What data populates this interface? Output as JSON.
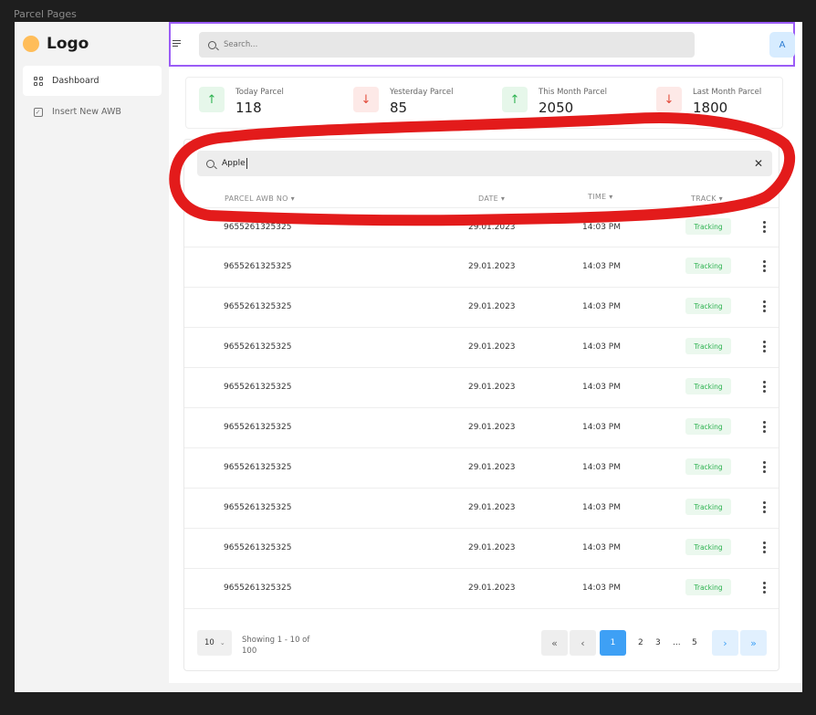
{
  "frame_label": "Parcel Pages",
  "logo": {
    "text": "Logo"
  },
  "sidebar": {
    "items": [
      {
        "label": "Dashboard",
        "icon": "dashboard-grid-icon"
      },
      {
        "label": "Insert New AWB",
        "icon": "checkbox-icon"
      }
    ]
  },
  "topbar": {
    "search_placeholder": "Search...",
    "avatar_initial": "A"
  },
  "stats": [
    {
      "label": "Today Parcel",
      "value": "118",
      "trend": "up"
    },
    {
      "label": "Yesterday Parcel",
      "value": "85",
      "trend": "down"
    },
    {
      "label": "This Month Parcel",
      "value": "2050",
      "trend": "up"
    },
    {
      "label": "Last Month Parcel",
      "value": "1800",
      "trend": "down"
    }
  ],
  "filter": {
    "value": "Apple"
  },
  "table": {
    "headers": {
      "awb": "PARCEL AWB NO ▾",
      "date": "DATE ▾",
      "time": "TIME ▾",
      "track": "TRACK ▾"
    },
    "rows": [
      {
        "awb": "9655261325325",
        "date": "29.01.2023",
        "time": "14:03 PM",
        "track": "Tracking"
      },
      {
        "awb": "9655261325325",
        "date": "29.01.2023",
        "time": "14:03 PM",
        "track": "Tracking"
      },
      {
        "awb": "9655261325325",
        "date": "29.01.2023",
        "time": "14:03 PM",
        "track": "Tracking"
      },
      {
        "awb": "9655261325325",
        "date": "29.01.2023",
        "time": "14:03 PM",
        "track": "Tracking"
      },
      {
        "awb": "9655261325325",
        "date": "29.01.2023",
        "time": "14:03 PM",
        "track": "Tracking"
      },
      {
        "awb": "9655261325325",
        "date": "29.01.2023",
        "time": "14:03 PM",
        "track": "Tracking"
      },
      {
        "awb": "9655261325325",
        "date": "29.01.2023",
        "time": "14:03 PM",
        "track": "Tracking"
      },
      {
        "awb": "9655261325325",
        "date": "29.01.2023",
        "time": "14:03 PM",
        "track": "Tracking"
      },
      {
        "awb": "9655261325325",
        "date": "29.01.2023",
        "time": "14:03 PM",
        "track": "Tracking"
      },
      {
        "awb": "9655261325325",
        "date": "29.01.2023",
        "time": "14:03 PM",
        "track": "Tracking"
      }
    ]
  },
  "pagination": {
    "per_page": "10",
    "showing_text": "Showing 1 - 10 of 100",
    "first": "«",
    "prev": "‹",
    "current": "1",
    "pages": [
      "2",
      "3",
      "...",
      "5"
    ],
    "next": "›",
    "last": "»"
  },
  "colors": {
    "accent": "#3ea0f5",
    "success": "#2cb24f",
    "danger": "#e34a3a",
    "annotation_red": "#e31b1b",
    "selection_purple": "#9b5cf6"
  }
}
